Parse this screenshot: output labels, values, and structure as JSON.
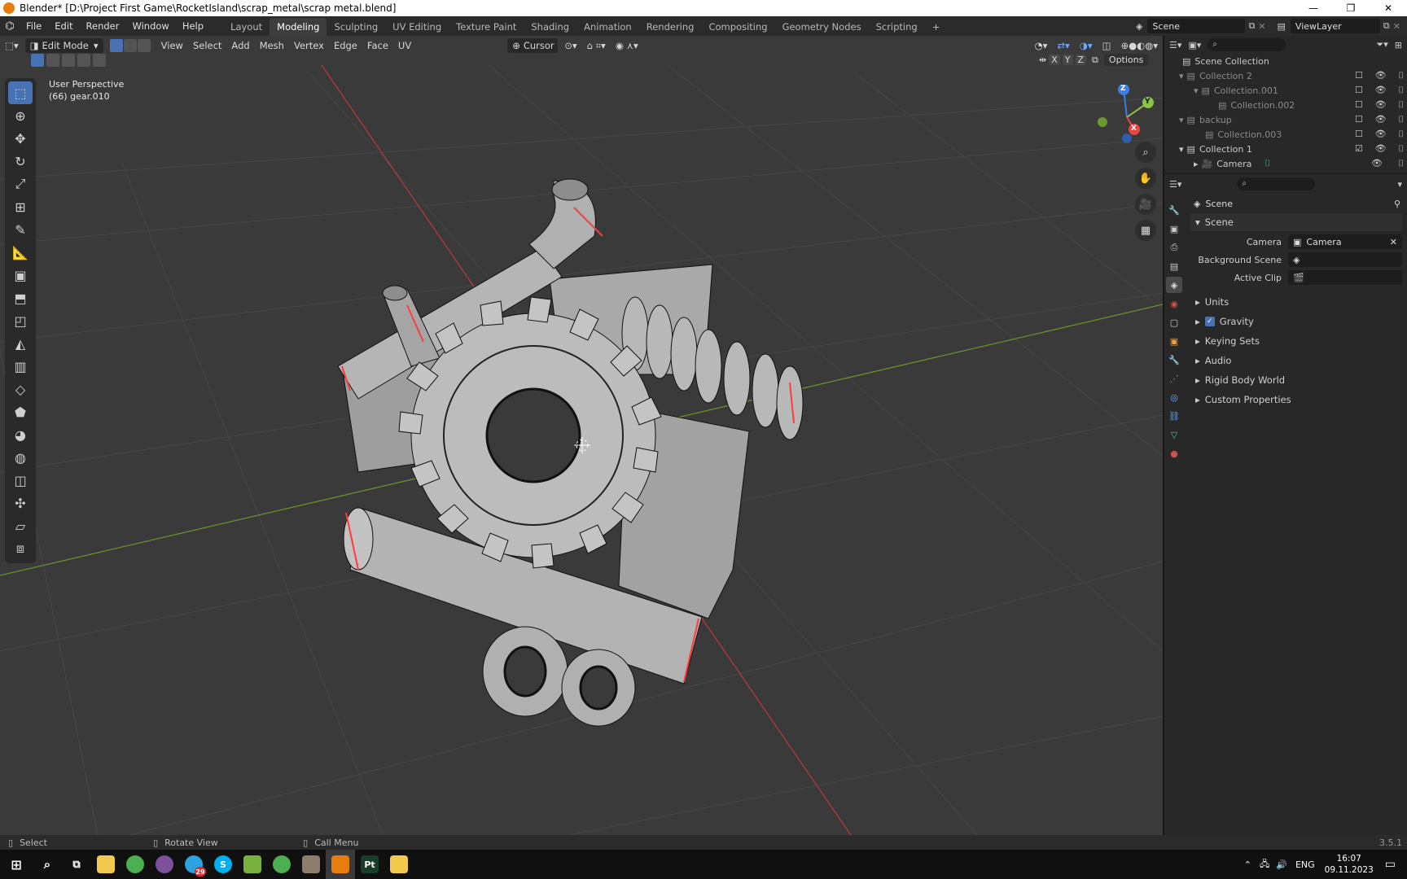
{
  "window": {
    "title": "Blender* [D:\\Project First Game\\RocketIsland\\scrap_metal\\scrap metal.blend]"
  },
  "menu": [
    "File",
    "Edit",
    "Render",
    "Window",
    "Help"
  ],
  "workspaces": [
    "Layout",
    "Modeling",
    "Sculpting",
    "UV Editing",
    "Texture Paint",
    "Shading",
    "Animation",
    "Rendering",
    "Compositing",
    "Geometry Nodes",
    "Scripting"
  ],
  "active_workspace": "Modeling",
  "scene_selector": "Scene",
  "view_layer": "ViewLayer",
  "viewport_header": {
    "mode": "Edit Mode",
    "menus": [
      "View",
      "Select",
      "Add",
      "Mesh",
      "Vertex",
      "Edge",
      "Face",
      "UV"
    ],
    "pivot": "Cursor",
    "axes": [
      "X",
      "Y",
      "Z"
    ],
    "options": "Options"
  },
  "viewport_overlay": {
    "view_name": "User Perspective",
    "object_name": "(66) gear.010"
  },
  "gizmo_axes": {
    "z": "Z",
    "y": "Y",
    "x": "X"
  },
  "outliner": {
    "rows": [
      {
        "label": "Scene Collection",
        "depth": 0
      },
      {
        "label": "Collection 2",
        "depth": 1
      },
      {
        "label": "Collection.001",
        "depth": 2
      },
      {
        "label": "Collection.002",
        "depth": 3
      },
      {
        "label": "backup",
        "depth": 1
      },
      {
        "label": "Collection.003",
        "depth": 2
      },
      {
        "label": "Collection 1",
        "depth": 1
      },
      {
        "label": "Camera",
        "depth": 2
      }
    ]
  },
  "properties": {
    "context": "Scene",
    "panel": "Scene",
    "fields": [
      {
        "label": "Camera",
        "value": "Camera"
      },
      {
        "label": "Background Scene",
        "value": ""
      },
      {
        "label": "Active Clip",
        "value": ""
      }
    ],
    "sections": [
      "Units",
      "Gravity",
      "Keying Sets",
      "Audio",
      "Rigid Body World",
      "Custom Properties"
    ]
  },
  "statusbar": {
    "select": "Select",
    "rotate": "Rotate View",
    "menu": "Call Menu",
    "version": "3.5.1"
  },
  "taskbar": {
    "lang": "ENG",
    "time": "16:07",
    "date": "09.11.2023",
    "badge": "29",
    "apps": [
      {
        "name": "file-explorer",
        "color": "#f2c94c",
        "glyph": ""
      },
      {
        "name": "chrome",
        "color": "#4caf50",
        "glyph": ""
      },
      {
        "name": "viber",
        "color": "#7b519d",
        "glyph": ""
      },
      {
        "name": "telegram",
        "color": "#2aa3e0",
        "glyph": ""
      },
      {
        "name": "skype",
        "color": "#00aff0",
        "glyph": "S"
      },
      {
        "name": "notepad-plus",
        "color": "#78b23c",
        "glyph": ""
      },
      {
        "name": "chrome-2",
        "color": "#4caf50",
        "glyph": ""
      },
      {
        "name": "gimp",
        "color": "#8c7e6b",
        "glyph": ""
      },
      {
        "name": "blender",
        "color": "#e87d0d",
        "glyph": ""
      },
      {
        "name": "substance-painter",
        "color": "#1a3d2a",
        "glyph": "Pt"
      },
      {
        "name": "folder",
        "color": "#f2c94c",
        "glyph": ""
      }
    ]
  },
  "colors": {
    "accent": "#4772b3",
    "x_axis": "#e84545",
    "y_axis": "#8bc34a",
    "z_axis": "#3b7fe0",
    "seam": "#ff3b3b"
  }
}
